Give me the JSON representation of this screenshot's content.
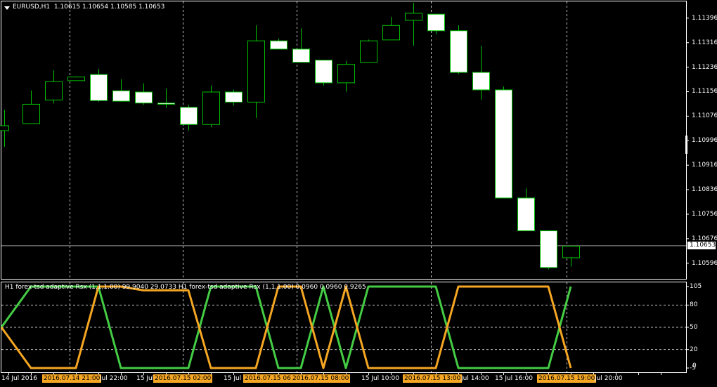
{
  "title_bar": {
    "symbol": "EURUSD,H1",
    "ohlc": "1.10615 1.10654 1.10585 1.10653"
  },
  "indicator_title": "H1 forex-tsd adaptive Rsx (1,1,1.00) 99.9040 29.0733  H1 forex-tsd adaptive Rsx (1,1,1.00) 0.0960 0.0960 0.9265",
  "colors": {
    "background": "#000000",
    "grid": "#C0C0C0",
    "candle_outline": "#00C000",
    "candle_fill": "#FFFFFF",
    "rsx_up": "#44CC44",
    "rsx_down": "#F5A623",
    "highlight_label": "#F5A623"
  },
  "price_axis": [
    "1.11396",
    "1.11316",
    "1.11236",
    "1.11156",
    "1.11076",
    "1.10996",
    "1.10916",
    "1.10836",
    "1.10756",
    "1.10676",
    "1.10596"
  ],
  "current_price": "1.10653",
  "indicator_axis": [
    "105",
    "80",
    "50",
    "20",
    "-5"
  ],
  "indicator_axis_extra": "0",
  "time_axis": [
    {
      "text": "14 Jul 2016",
      "highlight": false
    },
    {
      "text": "2016.07.14 21:00",
      "highlight": true
    },
    {
      "text": "Jul 22:00",
      "highlight": false
    },
    {
      "text": "15 Jul",
      "highlight": false
    },
    {
      "text": "2016.07.15 02:00",
      "highlight": true
    },
    {
      "text": "15 Jul",
      "highlight": false
    },
    {
      "text": "2016.07.15 06:00",
      "highlight": true
    },
    {
      "text": "2016.07.15 08:00",
      "highlight": true
    },
    {
      "text": "15 Jul 10:00",
      "highlight": false
    },
    {
      "text": "2016.07.15 13:00",
      "highlight": true
    },
    {
      "text": "Jul 14:00",
      "highlight": false
    },
    {
      "text": "15 Jul 16:00",
      "highlight": false
    },
    {
      "text": "2016.07.15 19:00",
      "highlight": true
    },
    {
      "text": "Jul 20:00",
      "highlight": false
    }
  ],
  "chart_data": [
    {
      "type": "candlestick",
      "title": "EURUSD,H1",
      "ylim": [
        1.10545,
        1.11446
      ],
      "candles": [
        {
          "o": 1.1103,
          "h": 1.11096,
          "l": 1.10976,
          "c": 1.11046
        },
        {
          "o": 1.11053,
          "h": 1.1116,
          "l": 1.11053,
          "c": 1.11116
        },
        {
          "o": 1.1113,
          "h": 1.11226,
          "l": 1.11118,
          "c": 1.1119
        },
        {
          "o": 1.11193,
          "h": 1.11206,
          "l": 1.11193,
          "c": 1.11205
        },
        {
          "o": 1.11213,
          "h": 1.1123,
          "l": 1.11123,
          "c": 1.11128
        },
        {
          "o": 1.1116,
          "h": 1.11196,
          "l": 1.11123,
          "c": 1.11126
        },
        {
          "o": 1.11156,
          "h": 1.11183,
          "l": 1.11113,
          "c": 1.1112
        },
        {
          "o": 1.1112,
          "h": 1.11166,
          "l": 1.11103,
          "c": 1.11116
        },
        {
          "o": 1.11106,
          "h": 1.11113,
          "l": 1.1103,
          "c": 1.1105
        },
        {
          "o": 1.1105,
          "h": 1.11176,
          "l": 1.1104,
          "c": 1.11156
        },
        {
          "o": 1.11156,
          "h": 1.11163,
          "l": 1.1111,
          "c": 1.11123
        },
        {
          "o": 1.11123,
          "h": 1.11373,
          "l": 1.1107,
          "c": 1.11323
        },
        {
          "o": 1.11323,
          "h": 1.1133,
          "l": 1.11296,
          "c": 1.11296
        },
        {
          "o": 1.11296,
          "h": 1.11363,
          "l": 1.11253,
          "c": 1.11253
        },
        {
          "o": 1.1126,
          "h": 1.1126,
          "l": 1.11176,
          "c": 1.11186
        },
        {
          "o": 1.11186,
          "h": 1.11256,
          "l": 1.11156,
          "c": 1.11246
        },
        {
          "o": 1.11253,
          "h": 1.11326,
          "l": 1.11253,
          "c": 1.11323
        },
        {
          "o": 1.11326,
          "h": 1.114,
          "l": 1.11326,
          "c": 1.11373
        },
        {
          "o": 1.1139,
          "h": 1.11446,
          "l": 1.11306,
          "c": 1.11413
        },
        {
          "o": 1.1141,
          "h": 1.1141,
          "l": 1.11343,
          "c": 1.11356
        },
        {
          "o": 1.11356,
          "h": 1.11373,
          "l": 1.11213,
          "c": 1.1122
        },
        {
          "o": 1.1122,
          "h": 1.11306,
          "l": 1.1113,
          "c": 1.11163
        },
        {
          "o": 1.11163,
          "h": 1.11173,
          "l": 1.1081,
          "c": 1.1081
        },
        {
          "o": 1.1081,
          "h": 1.1084,
          "l": 1.10703,
          "c": 1.10703
        },
        {
          "o": 1.10703,
          "h": 1.10703,
          "l": 1.10576,
          "c": 1.10583
        },
        {
          "o": 1.10615,
          "h": 1.10654,
          "l": 1.10585,
          "c": 1.10653
        }
      ]
    },
    {
      "type": "line",
      "title": "H1 forex-tsd adaptive Rsx (1,1,1.00)",
      "ylim": [
        -5,
        105
      ],
      "series": [
        {
          "values": [
            50,
            105,
            105,
            105,
            105,
            -5,
            -5,
            -5,
            -5,
            105,
            105,
            105,
            -5,
            -5,
            105,
            -5,
            105,
            105,
            105,
            105,
            -5,
            -5,
            -5,
            -5,
            -5,
            105
          ]
        },
        {
          "values": [
            50,
            -5,
            -5,
            -5,
            105,
            105,
            99.9,
            99.9,
            99.9,
            -5,
            -5,
            -5,
            105,
            105,
            -5,
            105,
            -5,
            -5,
            -5,
            -5,
            105,
            105,
            105,
            105,
            105,
            -5
          ]
        }
      ]
    }
  ]
}
